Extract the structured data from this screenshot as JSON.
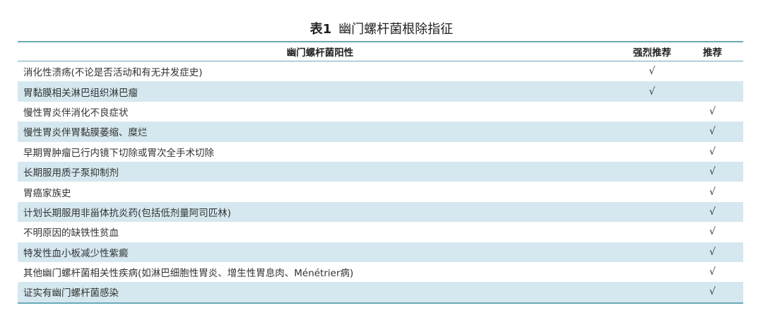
{
  "caption": {
    "number": "表1",
    "title": "幽门螺杆菌根除指征"
  },
  "columns": {
    "condition": "幽门螺杆菌阳性",
    "strong": "强烈推荐",
    "recommend": "推荐"
  },
  "rows": [
    {
      "condition": "消化性溃疡(不论是否活动和有无并发症史)",
      "strong": "√",
      "recommend": ""
    },
    {
      "condition": "胃黏膜相关淋巴组织淋巴瘤",
      "strong": "√",
      "recommend": ""
    },
    {
      "condition": "慢性胃炎伴消化不良症状",
      "strong": "",
      "recommend": "√"
    },
    {
      "condition": "慢性胃炎伴胃黏膜萎缩、糜烂",
      "strong": "",
      "recommend": "√"
    },
    {
      "condition": "早期胃肿瘤已行内镜下切除或胃次全手术切除",
      "strong": "",
      "recommend": "√"
    },
    {
      "condition": "长期服用质子泵抑制剂",
      "strong": "",
      "recommend": "√"
    },
    {
      "condition": "胃癌家族史",
      "strong": "",
      "recommend": "√"
    },
    {
      "condition": "计划长期服用非甾体抗炎药(包括低剂量阿司匹林)",
      "strong": "",
      "recommend": "√"
    },
    {
      "condition": "不明原因的缺铁性贫血",
      "strong": "",
      "recommend": "√"
    },
    {
      "condition": "特发性血小板减少性紫癜",
      "strong": "",
      "recommend": "√"
    },
    {
      "condition": "其他幽门螺杆菌相关性疾病(如淋巴细胞性胃炎、增生性胃息肉、Ménétrier病)",
      "strong": "",
      "recommend": "√"
    },
    {
      "condition": "证实有幽门螺杆菌感染",
      "strong": "",
      "recommend": "√"
    }
  ],
  "colors": {
    "rule": "#6aaab7",
    "shade": "#d5e8ef",
    "text": "#333333"
  }
}
